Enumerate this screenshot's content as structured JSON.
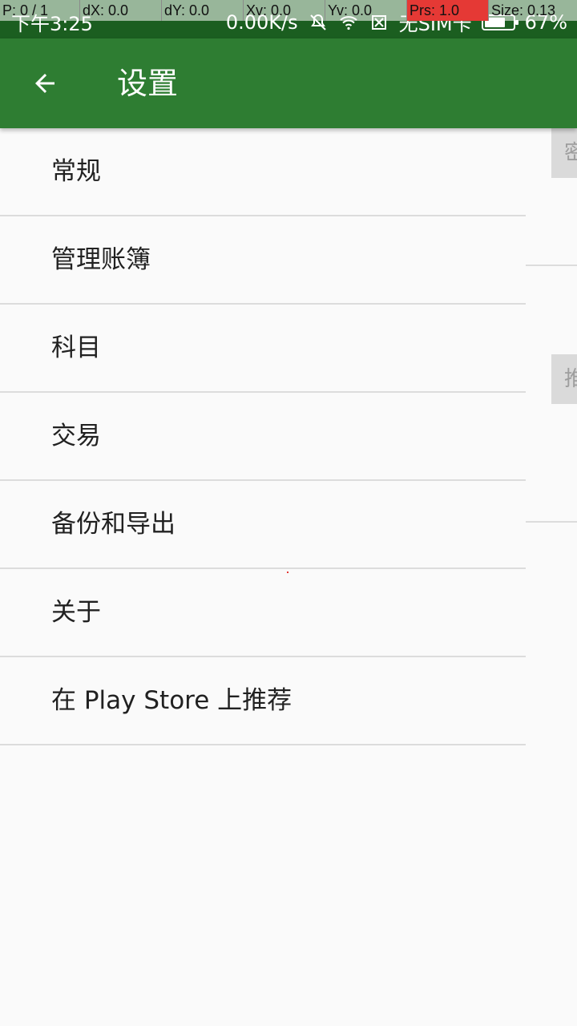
{
  "status_bar": {
    "time": "下午3:25",
    "net_speed": "0.00K/s",
    "sim": "无SIM卡",
    "battery": "67%",
    "icons": [
      "mute-bell-icon",
      "wifi-icon",
      "no-sim-icon",
      "battery-icon"
    ]
  },
  "debug_overlay": {
    "p": "P: 0 / 1",
    "dx": "dX: 0.0",
    "dy": "dY: 0.0",
    "xv": "Xv: 0.0",
    "yv": "Yv: 0.0",
    "prs": "Prs: 1.0",
    "size": "Size: 0.13"
  },
  "appbar": {
    "title": "设置",
    "back_icon": "arrow-left-icon"
  },
  "settings": {
    "items": [
      {
        "label": "常规"
      },
      {
        "label": "管理账簿"
      },
      {
        "label": "科目"
      },
      {
        "label": "交易"
      },
      {
        "label": "备份和导出"
      },
      {
        "label": "关于"
      },
      {
        "label": "在 Play Store 上推荐"
      }
    ]
  },
  "side_pane": {
    "button1_partial": "密",
    "button2_partial": "推"
  },
  "colors": {
    "primary": "#2e7d32",
    "primary_dark": "#1b5e20",
    "background": "#fafafa",
    "divider": "#dcdcdc"
  }
}
